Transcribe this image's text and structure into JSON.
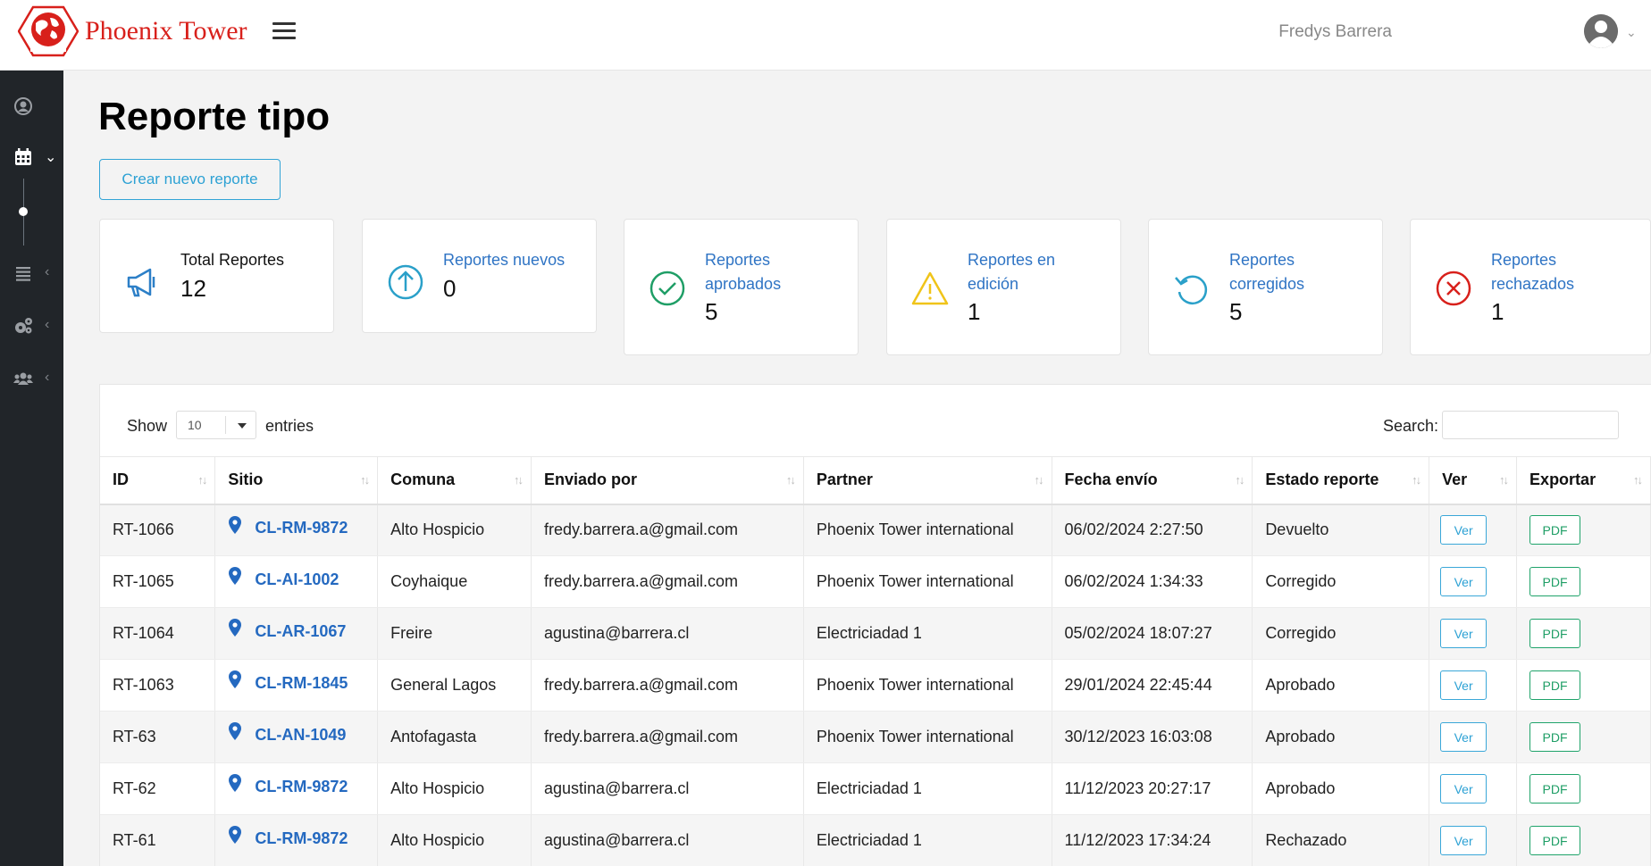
{
  "header": {
    "brand": "Phoenix Tower",
    "user_name": "Fredys Barrera"
  },
  "page": {
    "title": "Reporte tipo",
    "new_button": "Crear nuevo reporte"
  },
  "cards": [
    {
      "label": "Total Reportes",
      "value": "12",
      "icon": "megaphone-icon",
      "color": "#2c7fc7"
    },
    {
      "label": "Reportes nuevos",
      "value": "0",
      "icon": "arrow-up-circle-icon",
      "color": "#2aa0c9"
    },
    {
      "label": "Reportes aprobados",
      "value": "5",
      "icon": "check-circle-icon",
      "color": "#1f9e66"
    },
    {
      "label": "Reportes en edición",
      "value": "1",
      "icon": "warning-icon",
      "color": "#f0c419"
    },
    {
      "label": "Reportes corregidos",
      "value": "5",
      "icon": "refresh-icon",
      "color": "#2aa0c9"
    },
    {
      "label": "Reportes rechazados",
      "value": "1",
      "icon": "x-circle-icon",
      "color": "#d8201b"
    }
  ],
  "table_controls": {
    "show_label": "Show",
    "page_size": "10",
    "entries_label": "entries",
    "search_label": "Search:"
  },
  "columns": [
    "ID",
    "Sitio",
    "Comuna",
    "Enviado por",
    "Partner",
    "Fecha envío",
    "Estado reporte",
    "Ver",
    "Exportar"
  ],
  "rows": [
    {
      "id": "RT-1066",
      "sitio": "CL-RM-9872",
      "comuna": "Alto Hospicio",
      "enviado": "fredy.barrera.a@gmail.com",
      "partner": "Phoenix Tower international",
      "fecha": "06/02/2024 2:27:50",
      "estado": "Devuelto",
      "ver": "Ver",
      "pdf": "PDF"
    },
    {
      "id": "RT-1065",
      "sitio": "CL-AI-1002",
      "comuna": "Coyhaique",
      "enviado": "fredy.barrera.a@gmail.com",
      "partner": "Phoenix Tower international",
      "fecha": "06/02/2024 1:34:33",
      "estado": "Corregido",
      "ver": "Ver",
      "pdf": "PDF"
    },
    {
      "id": "RT-1064",
      "sitio": "CL-AR-1067",
      "comuna": "Freire",
      "enviado": "agustina@barrera.cl",
      "partner": "Electriciadad 1",
      "fecha": "05/02/2024 18:07:27",
      "estado": "Corregido",
      "ver": "Ver",
      "pdf": "PDF"
    },
    {
      "id": "RT-1063",
      "sitio": "CL-RM-1845",
      "comuna": "General Lagos",
      "enviado": "fredy.barrera.a@gmail.com",
      "partner": "Phoenix Tower international",
      "fecha": "29/01/2024 22:45:44",
      "estado": "Aprobado",
      "ver": "Ver",
      "pdf": "PDF"
    },
    {
      "id": "RT-63",
      "sitio": "CL-AN-1049",
      "comuna": "Antofagasta",
      "enviado": "fredy.barrera.a@gmail.com",
      "partner": "Phoenix Tower international",
      "fecha": "30/12/2023 16:03:08",
      "estado": "Aprobado",
      "ver": "Ver",
      "pdf": "PDF"
    },
    {
      "id": "RT-62",
      "sitio": "CL-RM-9872",
      "comuna": "Alto Hospicio",
      "enviado": "agustina@barrera.cl",
      "partner": "Electriciadad 1",
      "fecha": "11/12/2023 20:27:17",
      "estado": "Aprobado",
      "ver": "Ver",
      "pdf": "PDF"
    },
    {
      "id": "RT-61",
      "sitio": "CL-RM-9872",
      "comuna": "Alto Hospicio",
      "enviado": "agustina@barrera.cl",
      "partner": "Electriciadad 1",
      "fecha": "11/12/2023 17:34:24",
      "estado": "Rechazado",
      "ver": "Ver",
      "pdf": "PDF"
    }
  ],
  "colors": {
    "brand_red": "#d8201b",
    "sidebar_bg": "#212529",
    "link_blue": "#2469c0",
    "info_blue": "#2ca1d4",
    "success_green": "#1f9e66"
  }
}
